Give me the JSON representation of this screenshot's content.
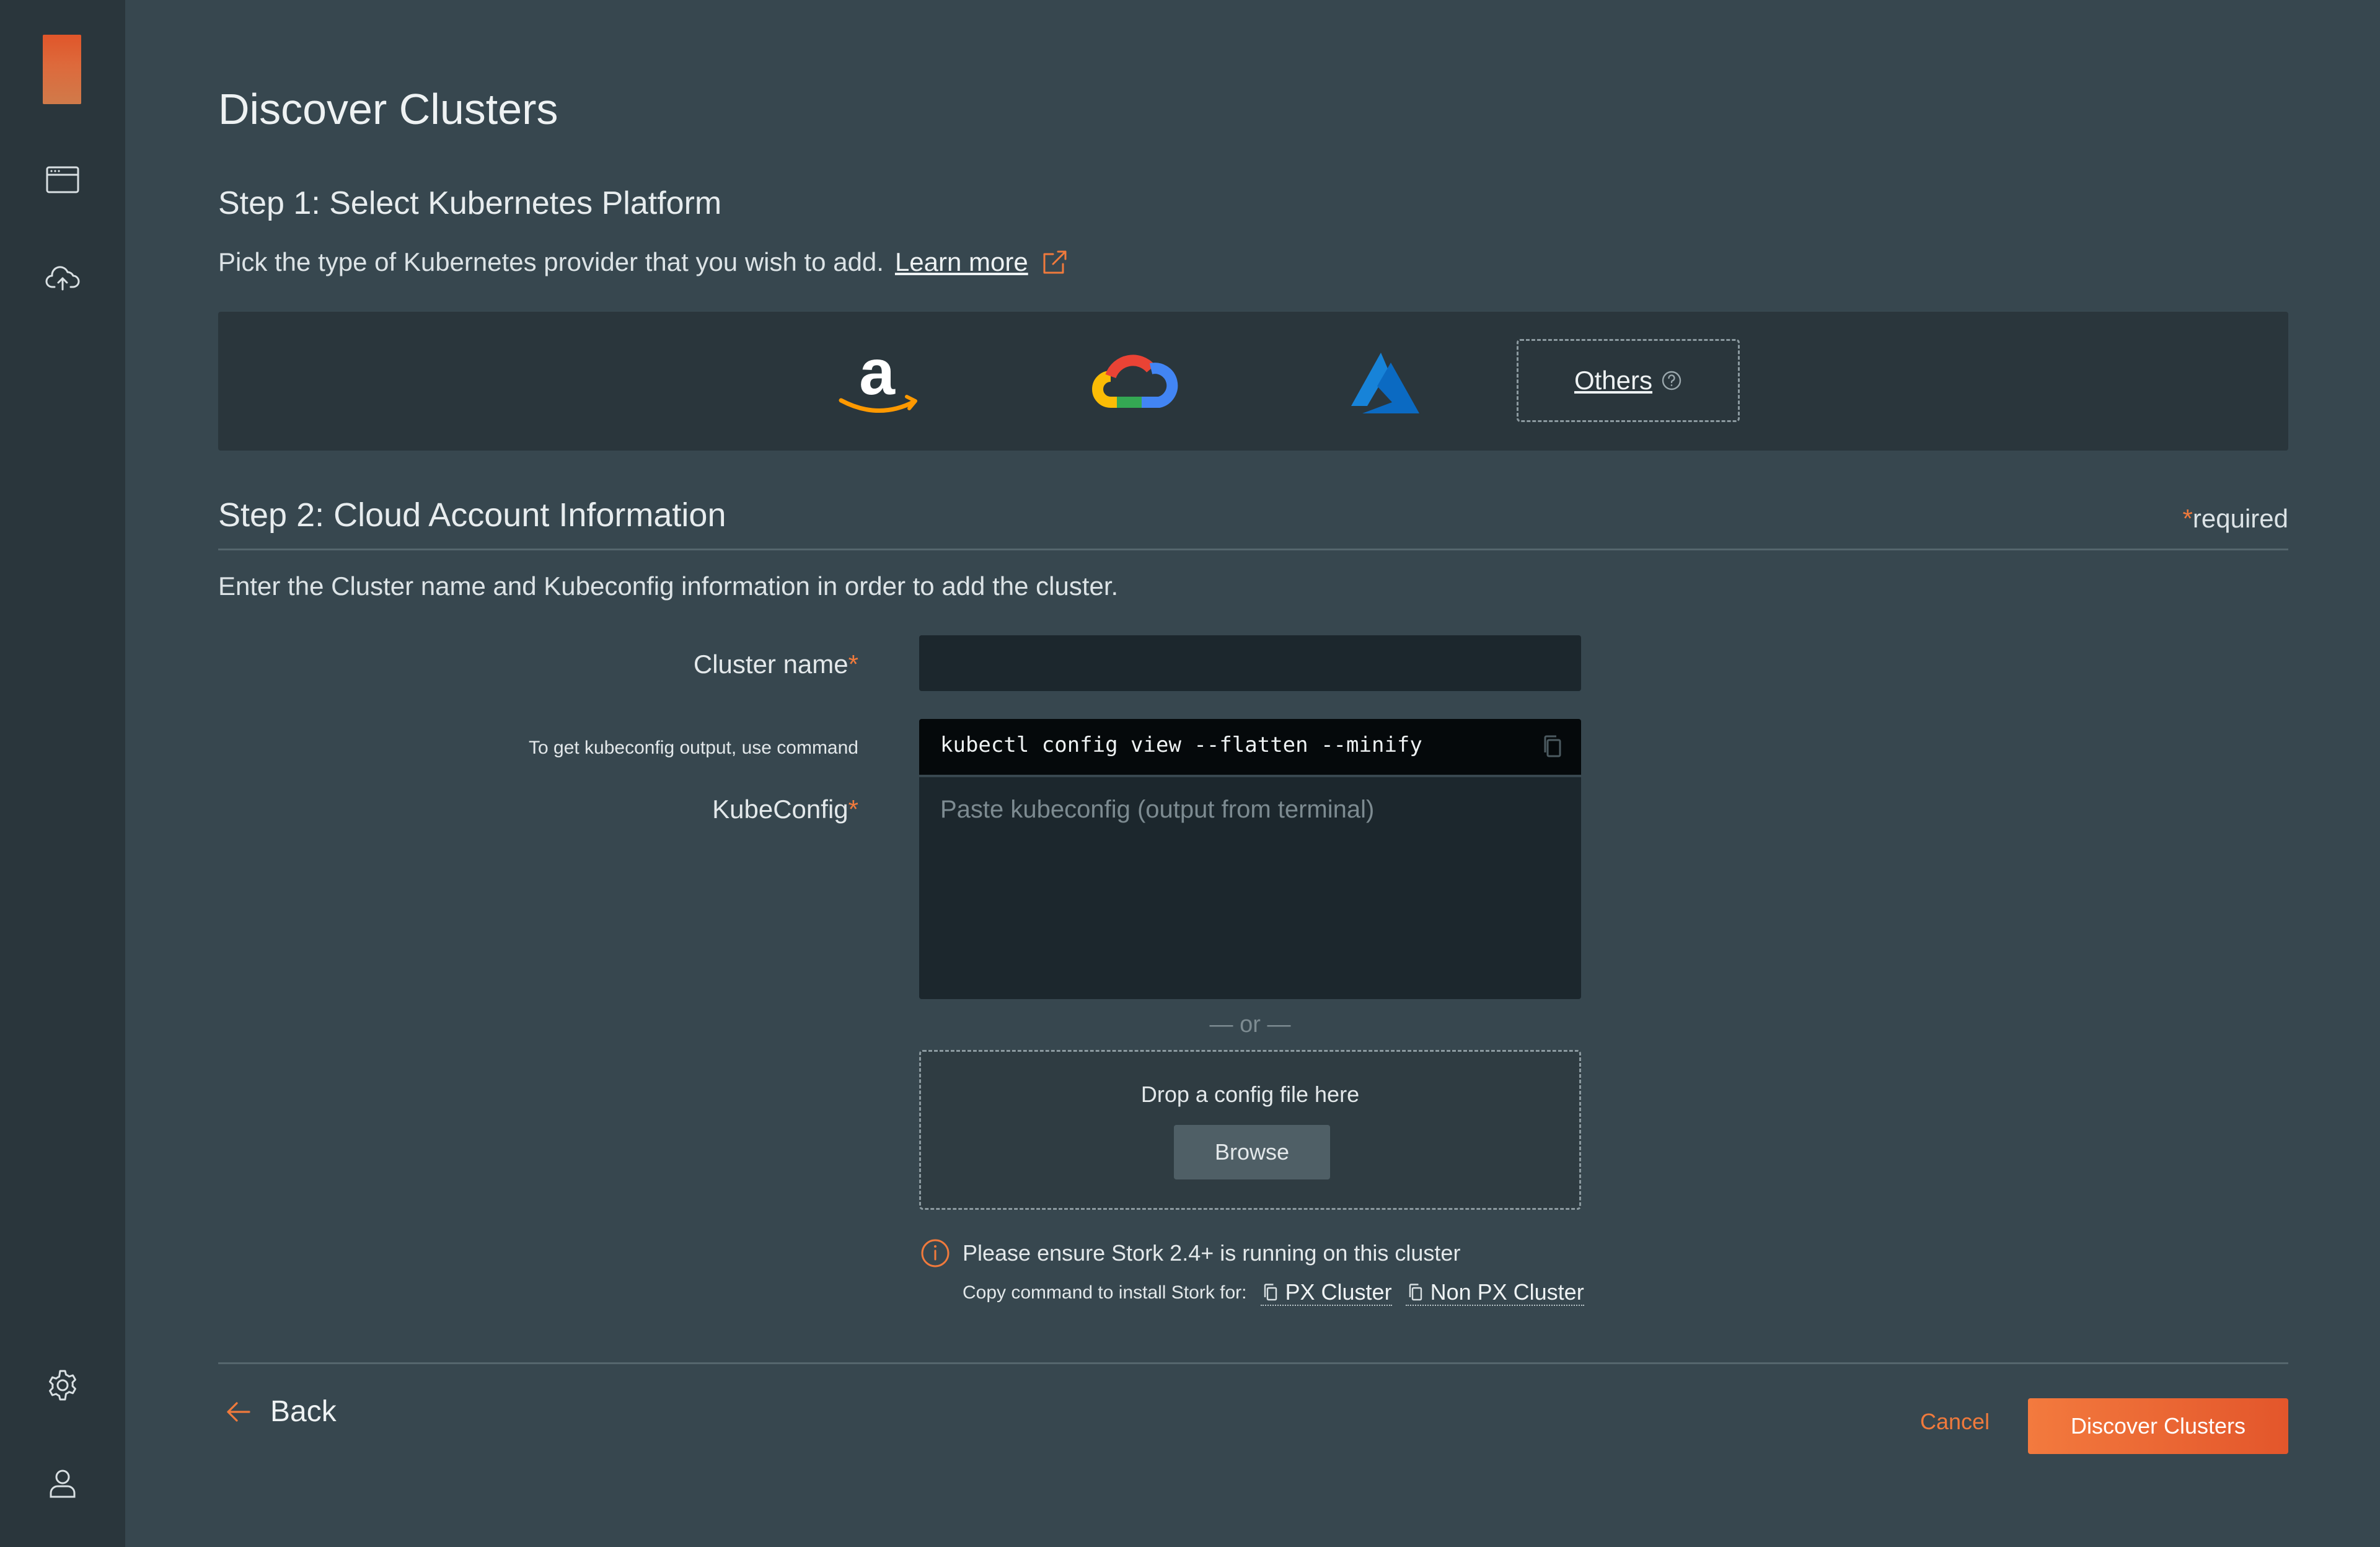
{
  "sidebar": {
    "icons": [
      "app-window-icon",
      "cloud-upload-icon",
      "gear-icon",
      "user-icon"
    ]
  },
  "page": {
    "title": "Discover Clusters"
  },
  "step1": {
    "title": "Step 1:  Select Kubernetes Platform",
    "description": "Pick the type of Kubernetes provider that you wish to add.",
    "learn_more": "Learn more",
    "providers": [
      "amazon",
      "google-cloud",
      "azure"
    ],
    "others_label": "Others"
  },
  "step2": {
    "title": "Step 2: Cloud Account Information",
    "required_label": "required",
    "asterisk": "*",
    "description": "Enter the Cluster name and Kubeconfig information in order to add the cluster.",
    "cluster_name_label": "Cluster name",
    "cluster_name_value": "",
    "kube_hint": "To get kubeconfig output, use command",
    "kube_command": "kubectl config view --flatten --minify",
    "kubeconfig_label": "KubeConfig",
    "kubeconfig_placeholder": "Paste kubeconfig (output from terminal)",
    "or_text": "— or —",
    "drop_text": "Drop a config file here",
    "browse_label": "Browse",
    "stork_note": "Please ensure Stork 2.4+ is running on this cluster",
    "stork_copy_prefix": "Copy command to install Stork for:",
    "px_cluster": "PX Cluster",
    "non_px_cluster": "Non PX Cluster"
  },
  "footer": {
    "back_label": "Back",
    "cancel_label": "Cancel",
    "discover_label": "Discover Clusters"
  },
  "colors": {
    "background": "#37474f",
    "sidebar": "#2a363c",
    "accent": "#f07a3c",
    "amazon_orange": "#ff9900",
    "azure_blue": "#0078d4"
  }
}
